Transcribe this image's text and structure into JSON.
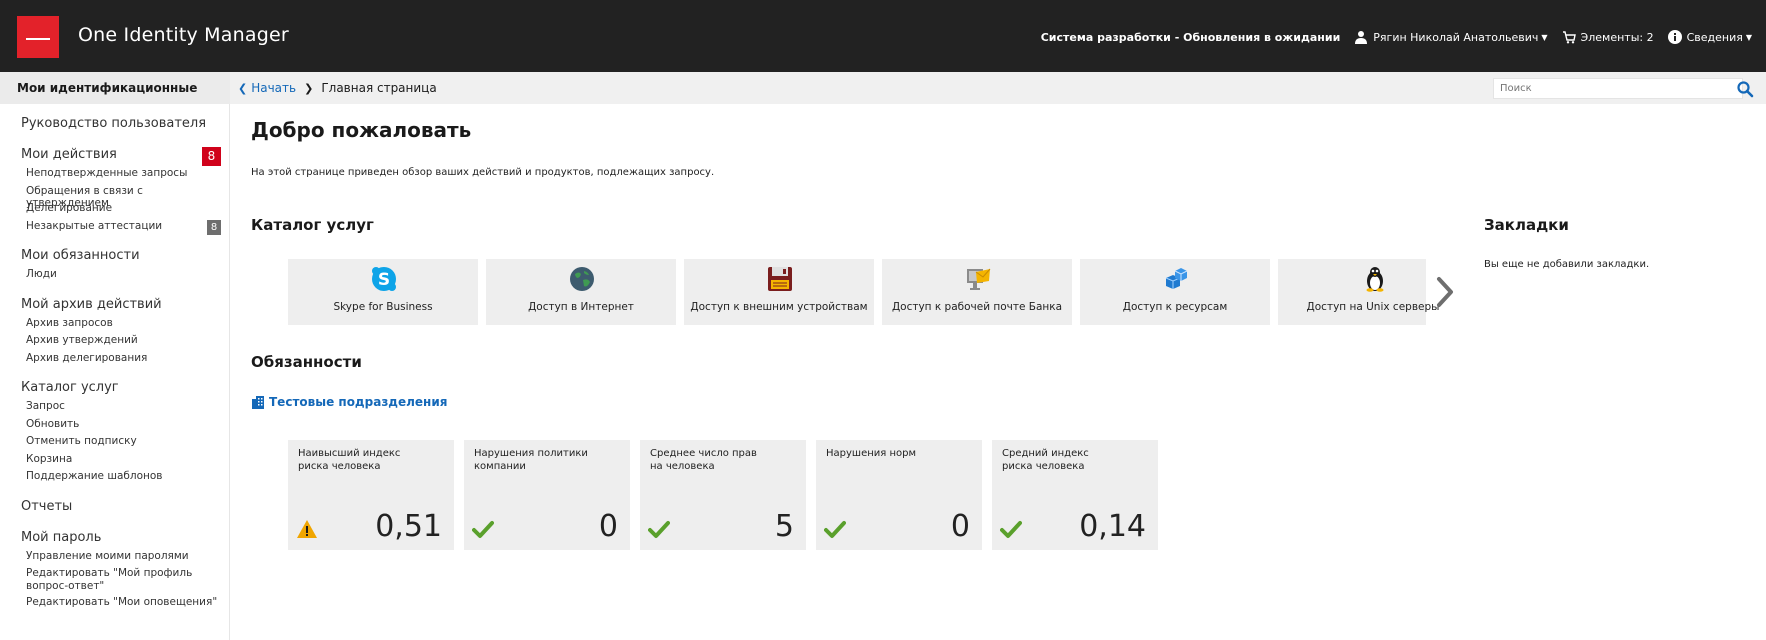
{
  "header": {
    "app_title": "One Identity Manager",
    "system_status": "Система разработки - Обновления в ожидании",
    "user_name": "Рягин Николай Анатольевич",
    "cart_label": "Элементы: 2",
    "info_label": "Сведения",
    "brand_color": "#e3222a"
  },
  "subbar": {
    "section": "Мои идентификационные",
    "breadcrumb_home": "Начать",
    "breadcrumb_current": "Главная страница",
    "search_placeholder": "Поиск"
  },
  "sidebar": {
    "user_guide": "Руководство пользователя",
    "my_actions": {
      "label": "Мои действия",
      "badge": "8"
    },
    "my_actions_items": [
      "Неподтвержденные запросы",
      "Обращения в связи с утверждением",
      "Делегирование"
    ],
    "open_attestations": {
      "label": "Незакрытые аттестации",
      "badge": "8"
    },
    "my_duties": "Мои обязанности",
    "my_duties_items": [
      "Люди"
    ],
    "action_archive": "Мой архив действий",
    "action_archive_items": [
      "Архив запросов",
      "Архив утверждений",
      "Архив делегирования"
    ],
    "service_catalog": "Каталог услуг",
    "service_catalog_items": [
      "Запрос",
      "Обновить",
      "Отменить подписку",
      "Корзина",
      "Поддержание шаблонов"
    ],
    "reports": "Отчеты",
    "my_password": "Мой пароль",
    "my_password_items": [
      "Управление моими паролями",
      "Редактировать \"Мой профиль вопрос-ответ\"",
      "Редактировать \"Мои оповещения\""
    ]
  },
  "main": {
    "title": "Добро пожаловать",
    "intro": "На этой странице приведен обзор ваших действий и продуктов, подлежащих запросу.",
    "catalog_title": "Каталог услуг",
    "catalog_tiles": [
      {
        "label": "Skype for Business",
        "icon": "skype-icon"
      },
      {
        "label": "Доступ в Интернет",
        "icon": "globe-icon"
      },
      {
        "label": "Доступ к внешним устройствам",
        "icon": "floppy-disk-icon"
      },
      {
        "label": "Доступ к рабочей почте Банка",
        "icon": "mail-monitor-icon"
      },
      {
        "label": "Доступ к ресурсам",
        "icon": "cubes-icon"
      },
      {
        "label": "Доступ на Unix серверы",
        "icon": "linux-penguin-icon"
      }
    ],
    "duties_title": "Обязанности",
    "department_link": "Тестовые подразделения",
    "kpis": [
      {
        "label": "Наивысший индекс риска человека",
        "value": "0,51",
        "status": "warning"
      },
      {
        "label": "Нарушения политики компании",
        "value": "0",
        "status": "ok"
      },
      {
        "label": "Среднее число прав на человека",
        "value": "5",
        "status": "ok"
      },
      {
        "label": "Нарушения норм",
        "value": "0",
        "status": "ok"
      },
      {
        "label": "Средний индекс риска человека",
        "value": "0,14",
        "status": "ok"
      }
    ],
    "bookmarks_title": "Закладки",
    "bookmarks_empty": "Вы еще не добавили закладки."
  }
}
